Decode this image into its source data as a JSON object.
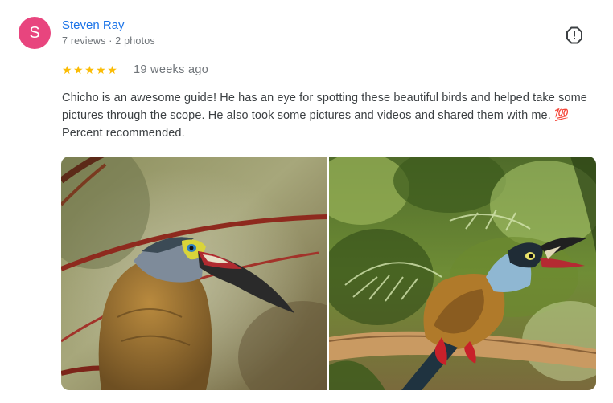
{
  "reviewer": {
    "initial": "S",
    "name": "Steven Ray",
    "meta": "7 reviews · 2 photos",
    "avatar_color": "#e8457e"
  },
  "rating": {
    "stars": 5,
    "stars_text": "★★★★★",
    "time": "19 weeks ago"
  },
  "review_text": "Chicho is an awesome guide! He has an eye for spotting these beautiful birds and helped take some pictures through the scope. He also took some pictures and videos and shared them with me. 💯 Percent recommended.",
  "icons": {
    "report": "report-flag-icon"
  },
  "colors": {
    "name_link": "#1a73e8",
    "star": "#fbbc04",
    "meta": "#70757a"
  }
}
